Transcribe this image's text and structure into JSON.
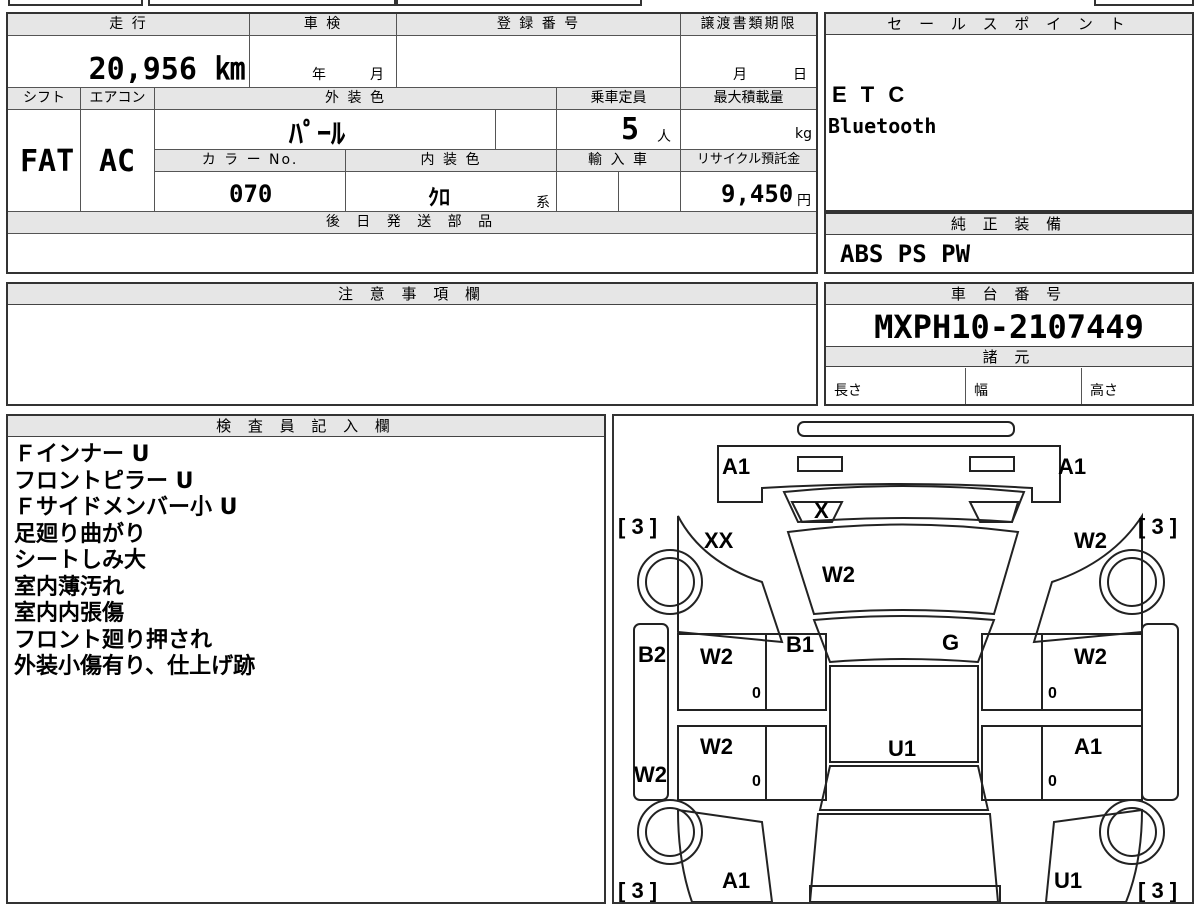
{
  "header": {
    "mileage_label": "走 行",
    "inspection_label": "車 検",
    "registration_label": "登 録 番 号",
    "transfer_label": "譲渡書類期限",
    "mileage_value": "20,956 ㎞",
    "year_label": "年",
    "month_label": "月",
    "tmonth_label": "月",
    "tday_label": "日"
  },
  "specs": {
    "shift_label": "シフト",
    "ac_label": "エアコン",
    "exterior_color_label": "外 装 色",
    "capacity_label": "乗車定員",
    "max_load_label": "最大積載量",
    "shift_value": "FAT",
    "ac_value": "AC",
    "exterior_color_value": "ﾊﾟｰﾙ",
    "capacity_value": "5",
    "capacity_unit": "人",
    "load_unit": "kg",
    "color_no_label": "カ ラ ー No.",
    "interior_color_label": "内 装 色",
    "import_label": "輸 入 車",
    "recycle_label": "リサイクル預託金",
    "color_no_value": "070",
    "interior_color_value": "ｸﾛ",
    "interior_suffix": "系",
    "recycle_value": "9,450",
    "recycle_unit": "円"
  },
  "later_parts": {
    "label": "後 日 発 送 部 品"
  },
  "sales_points": {
    "label": "セ ー ル ス ポ イ ン ト",
    "items": [
      "E T C",
      "Bluetooth"
    ]
  },
  "genuine_equipment": {
    "label": "純 正 装 備",
    "value": "ABS PS PW"
  },
  "notes": {
    "label": "注 意 事 項 欄"
  },
  "chassis": {
    "label": "車 台 番 号",
    "value": "MXPH10-2107449"
  },
  "dimensions": {
    "label": "諸 元",
    "length": "長さ",
    "width": "幅",
    "height": "高さ"
  },
  "inspector": {
    "label": "検 査 員 記 入 欄",
    "lines": [
      "Ｆインナー U",
      "フロントピラー U",
      "Ｆサイドメンバー小 U",
      "足廻り曲がり",
      "シートしみ大",
      "室内薄汚れ",
      "室内内張傷",
      "フロント廻り押され",
      "外装小傷有り、仕上げ跡"
    ]
  },
  "diagram": {
    "labels": {
      "a1_fl": "A1",
      "a1_fr": "A1",
      "x": "X",
      "xx": "XX",
      "w2_hood": "W2",
      "w2_fr_fender": "W2",
      "b1": "B1",
      "g": "G",
      "b2": "B2",
      "w2_l_door1": "W2",
      "w2_r_door1": "W2",
      "w2_l_door2": "W2",
      "a1_r_door2": "A1",
      "u1_roof": "U1",
      "w2_l_sill": "W2",
      "a1_rl": "A1",
      "u1_rr": "U1",
      "tire_fl": "[ 3 ]",
      "tire_fr": "[ 3 ]",
      "tire_rl": "[ 3 ]",
      "tire_rr": "[ 3 ]",
      "zero_l1": "0",
      "zero_r1": "0",
      "zero_l2": "0",
      "zero_r2": "0"
    }
  }
}
